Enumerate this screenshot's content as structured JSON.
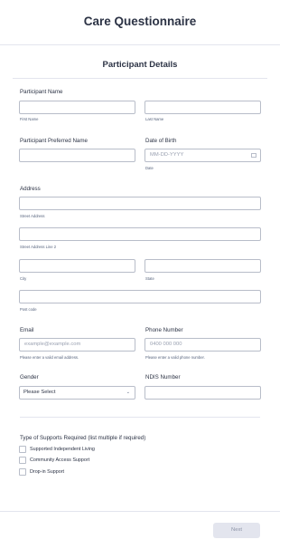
{
  "form": {
    "title": "Care Questionnaire"
  },
  "section": {
    "title": "Participant Details"
  },
  "participant_name": {
    "label": "Participant Name",
    "first_sub": "First Name",
    "last_sub": "Last Name",
    "first_value": "",
    "last_value": ""
  },
  "preferred_name": {
    "label": "Participant Preferred Name",
    "value": ""
  },
  "dob": {
    "label": "Date of Birth",
    "placeholder": "MM-DD-YYYY",
    "sub": "Date",
    "icon": "calendar-icon"
  },
  "address": {
    "label": "Address",
    "street_sub": "Street Address",
    "street2_sub": "Street Address Line 2",
    "city_sub": "City",
    "state_sub": "State",
    "postcode_sub": "Post code"
  },
  "email": {
    "label": "Email",
    "placeholder": "example@example.com",
    "sub": "Please enter a valid email address."
  },
  "phone": {
    "label": "Phone Number",
    "placeholder": "0400 000 000",
    "sub": "Please enter a valid phone number."
  },
  "gender": {
    "label": "Gender",
    "selected": "Please Select",
    "icon": "chevron-down-icon"
  },
  "ndis": {
    "label": "NDIS Number",
    "value": ""
  },
  "supports": {
    "label": "Type of Supports Required (list multiple if required)",
    "options": [
      "Supported Independent Living",
      "Community Access Support",
      "Drop-in Support"
    ]
  },
  "footer": {
    "next_label": "Next"
  },
  "colors": {
    "border": "#b8bdc9",
    "text": "#2c3345",
    "muted": "#57647e",
    "button_bg": "#e3e5ee"
  }
}
